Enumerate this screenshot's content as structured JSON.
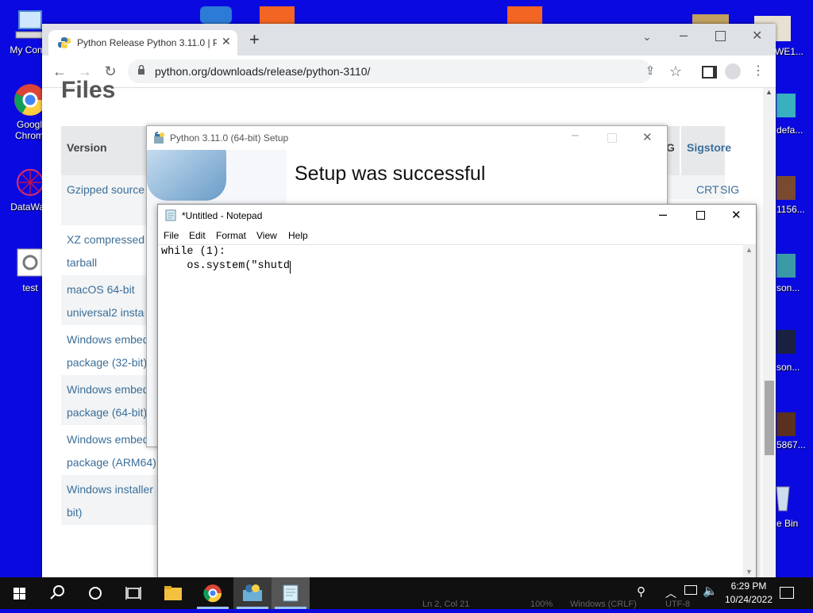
{
  "desktop": {
    "icons": [
      {
        "label": "My Comp"
      },
      {
        "label": "Googl Chrom"
      },
      {
        "label": "DataWag"
      },
      {
        "label": "test"
      }
    ],
    "right_icons": [
      {
        "label": "WE1..."
      },
      {
        "label": "defa..."
      },
      {
        "label": "1156..."
      },
      {
        "label": "son..."
      },
      {
        "label": "son..."
      },
      {
        "label": "5867..."
      },
      {
        "label": "e Bin"
      }
    ]
  },
  "chrome": {
    "tab_title": "Python Release Python 3.11.0 | P",
    "url": "python.org/downloads/release/python-3110/",
    "page": {
      "heading": "Files",
      "col_version": "Version",
      "col_g": "G",
      "col_sigstore": "Sigstore",
      "rows": [
        {
          "line1": "Gzipped source",
          "line2": "",
          "crt": "CRT",
          "sig": "SIG"
        },
        {
          "line1": "XZ compressed s",
          "line2": "tarball"
        },
        {
          "line1": "macOS 64-bit",
          "line2": "universal2 insta"
        },
        {
          "line1": "Windows embed",
          "line2": "package (32-bit)"
        },
        {
          "line1": "Windows embed",
          "line2": "package (64-bit)"
        },
        {
          "line1": "Windows embed",
          "line2": "package (ARM64)"
        },
        {
          "line1": "Windows installer",
          "line2": "bit)"
        }
      ]
    }
  },
  "setup": {
    "title": "Python 3.11.0 (64-bit) Setup",
    "heading": "Setup was successful"
  },
  "notepad": {
    "title": "*Untitled - Notepad",
    "menu": [
      "File",
      "Edit",
      "Format",
      "View",
      "Help"
    ],
    "line1": "while (1):",
    "line2": "    os.system(\"shutd",
    "status_pos": "Ln 2, Col 21",
    "status_zoom": "100%",
    "status_eol": "Windows (CRLF)",
    "status_enc": "UTF-8"
  },
  "taskbar": {
    "time": "6:29 PM",
    "date": "10/24/2022"
  }
}
